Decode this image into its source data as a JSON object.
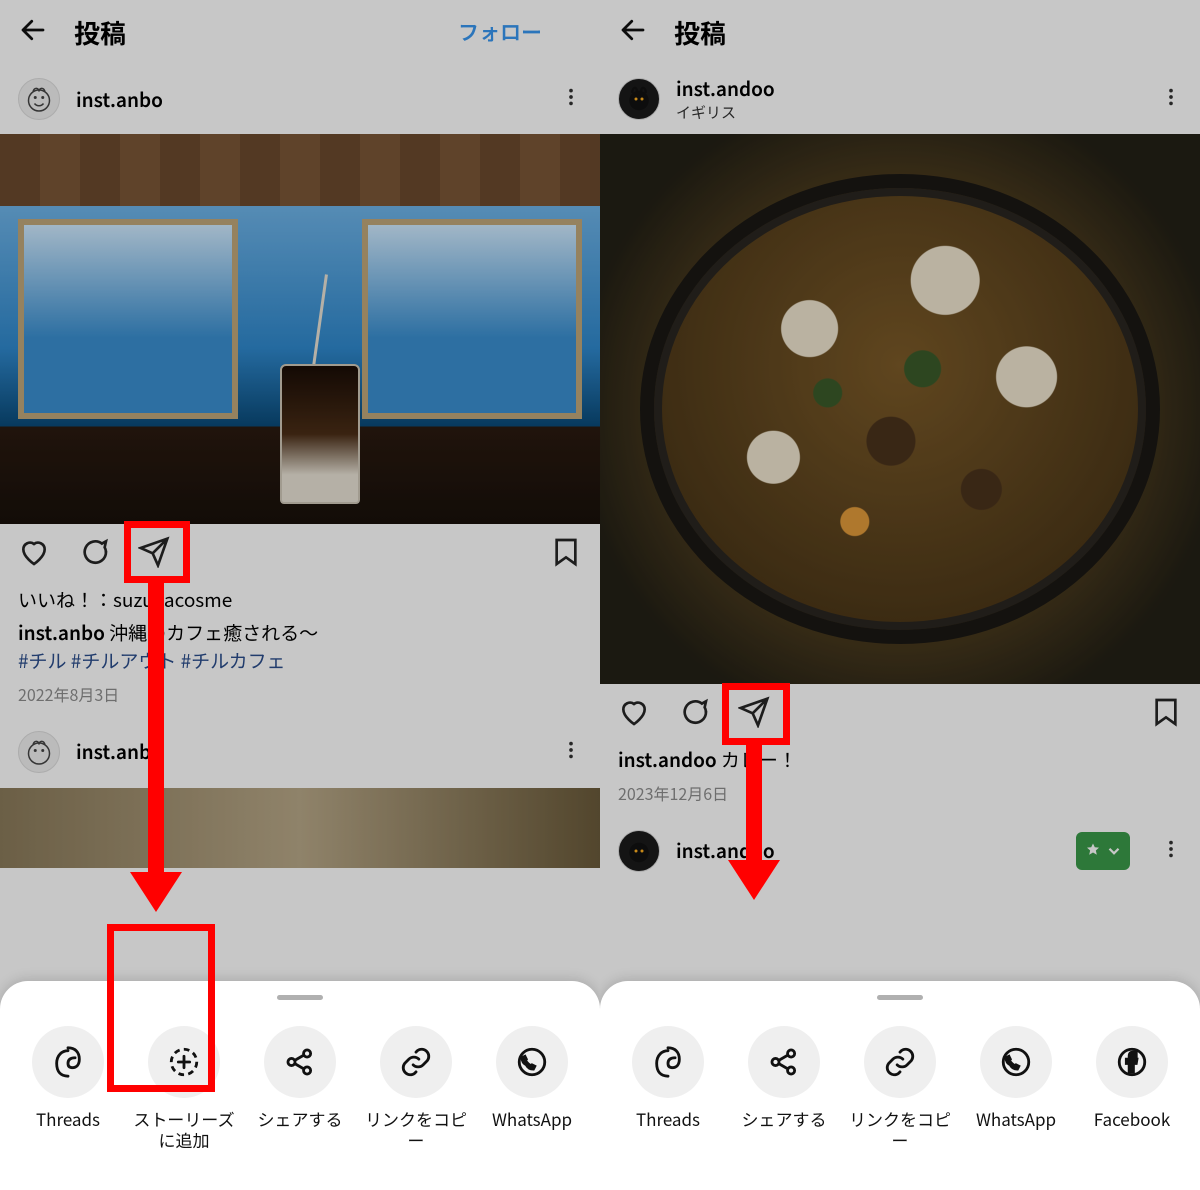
{
  "left": {
    "topbar": {
      "title": "投稿",
      "follow": "フォロー"
    },
    "post_header": {
      "username": "inst.anbo"
    },
    "actions": {
      "like": "heart",
      "comment": "speech",
      "share": "paper-plane",
      "save": "bookmark"
    },
    "caption": {
      "liked_by": "いいね！：suzukacosme",
      "username": "inst.anbo",
      "text": "沖縄のカフェ癒される〜",
      "tags": "#チル #チルアウト #チルカフェ",
      "date": "2022年8月3日"
    },
    "next_post_header": {
      "username": "inst.anbo"
    },
    "sheet": {
      "items": [
        {
          "icon": "threads",
          "label": "Threads"
        },
        {
          "icon": "add-story",
          "label": "ストーリーズに追加"
        },
        {
          "icon": "share",
          "label": "シェアする"
        },
        {
          "icon": "link",
          "label": "リンクをコピー"
        },
        {
          "icon": "whatsapp",
          "label": "WhatsApp"
        }
      ]
    }
  },
  "right": {
    "topbar": {
      "title": "投稿"
    },
    "post_header": {
      "username": "inst.andoo",
      "location": "イギリス"
    },
    "caption": {
      "username": "inst.andoo",
      "text": "カレー！",
      "date": "2023年12月6日"
    },
    "next_post_header": {
      "username": "inst.andoo"
    },
    "sheet": {
      "items": [
        {
          "icon": "threads",
          "label": "Threads"
        },
        {
          "icon": "share",
          "label": "シェアする"
        },
        {
          "icon": "link",
          "label": "リンクをコピー"
        },
        {
          "icon": "whatsapp",
          "label": "WhatsApp"
        },
        {
          "icon": "facebook",
          "label": "Facebook"
        }
      ]
    }
  }
}
